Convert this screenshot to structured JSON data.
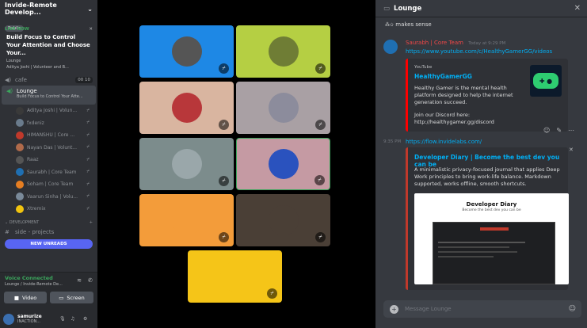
{
  "server": {
    "name": "Invide-Remote Develop...",
    "badge": "Public"
  },
  "stage_live": {
    "label": "LIVE NOW",
    "title": "Build Focus to Control Your Attention and Choose Your...",
    "channel": "Lounge",
    "members": "Aditya Joshi | Volunteer and B..."
  },
  "channels": {
    "cafe": "cafe",
    "cafe_count": "00",
    "cafe_limit": "10",
    "lounge": "Lounge",
    "lounge_topic": "Build Focus to Control Your Atte..."
  },
  "voice_users": [
    {
      "name": "Aditya Joshi | Volun...",
      "color": "#3a3a3a"
    },
    {
      "name": "fxdeniz",
      "color": "#6a7b8c"
    },
    {
      "name": "HIMANSHU | Core ...",
      "color": "#c0392b"
    },
    {
      "name": "Nayan Das | Volunt...",
      "color": "#b06a4a"
    },
    {
      "name": "Raaz",
      "color": "#555"
    },
    {
      "name": "Saurabh | Core Team",
      "color": "#1f6fb2"
    },
    {
      "name": "Soham | Core Team",
      "color": "#e67e22"
    },
    {
      "name": "Vaarun Sinha | Volu...",
      "color": "#7a8a9a"
    },
    {
      "name": "Xtremix",
      "color": "#f1c40f"
    }
  ],
  "category": "DEVELOPMENT",
  "side_channel": "side - projects",
  "new_unreads": "NEW UNREADS",
  "voice": {
    "status": "Voice Connected",
    "location": "Lounge / Invide-Remote De...",
    "video": "Video",
    "screen": "Screen"
  },
  "me": {
    "name": "samurize",
    "status": "INACTION..."
  },
  "tiles": [
    {
      "bg": "#1e88e5",
      "face": "#555"
    },
    {
      "bg": "#b5cf43",
      "face": "#6f7d35"
    },
    {
      "bg": "#d9b5a0",
      "face": "#b8373a"
    },
    {
      "bg": "#a9a0a4",
      "face": "#8c8c9c"
    },
    {
      "bg": "#7c8c8c",
      "face": "#9aa7aa"
    },
    {
      "bg": "#c59aa3",
      "face": "#2a52be"
    },
    {
      "bg": "#f39c3a",
      "face": "#f39c3a"
    },
    {
      "bg": "#4a3f36",
      "face": "#4a3f36"
    },
    {
      "bg": "#f5c518",
      "face": "#f5c518"
    }
  ],
  "chat": {
    "title": "Lounge",
    "prev_text": "makes sense",
    "author": "Saurabh | Core Team",
    "time": "Today at 9:29 PM",
    "link1": "https://www.youtube.com/c/HealthyGamerGG/videos",
    "embed1": {
      "provider": "YouTube",
      "title": "HealthyGamerGG",
      "desc": "Healthy Gamer is the mental health platform designed to help the internet generation succeed.",
      "discord": "Join our Discord here: http://healthygamer.gg/discord"
    },
    "time2": "9:35 PM",
    "link2": "https://flow.invidelabs.com/",
    "embed2": {
      "title": "Developer Diary | Become the best dev you can be",
      "desc": "A minimalistic privacy-focused journal that applies Deep Work principles to bring work-life balance. Markdown supported, works offline, smooth shortcuts.",
      "img_title": "Developer Diary",
      "img_sub": "Become the best dev you can be"
    },
    "placeholder": "Message Lounge"
  }
}
